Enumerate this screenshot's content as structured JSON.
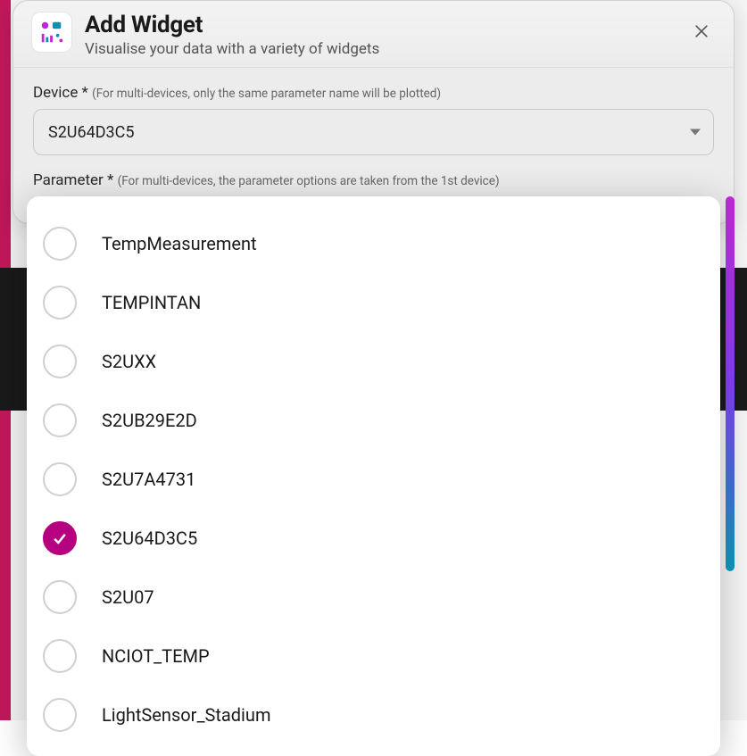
{
  "modal": {
    "title": "Add Widget",
    "subtitle": "Visualise your data with a variety of widgets"
  },
  "device": {
    "label": "Device *",
    "hint": "(For multi-devices, only the same parameter name will be plotted)",
    "selected": "S2U64D3C5"
  },
  "parameter": {
    "label": "Parameter *",
    "hint": "(For multi-devices, the parameter options are taken from the 1st device)"
  },
  "options": [
    {
      "label": "TempMeasurement",
      "selected": false
    },
    {
      "label": "TEMPINTAN",
      "selected": false
    },
    {
      "label": "S2UXX",
      "selected": false
    },
    {
      "label": "S2UB29E2D",
      "selected": false
    },
    {
      "label": "S2U7A4731",
      "selected": false
    },
    {
      "label": "S2U64D3C5",
      "selected": true
    },
    {
      "label": "S2U07",
      "selected": false
    },
    {
      "label": "NCIOT_TEMP",
      "selected": false
    },
    {
      "label": "LightSensor_Stadium",
      "selected": false
    }
  ]
}
